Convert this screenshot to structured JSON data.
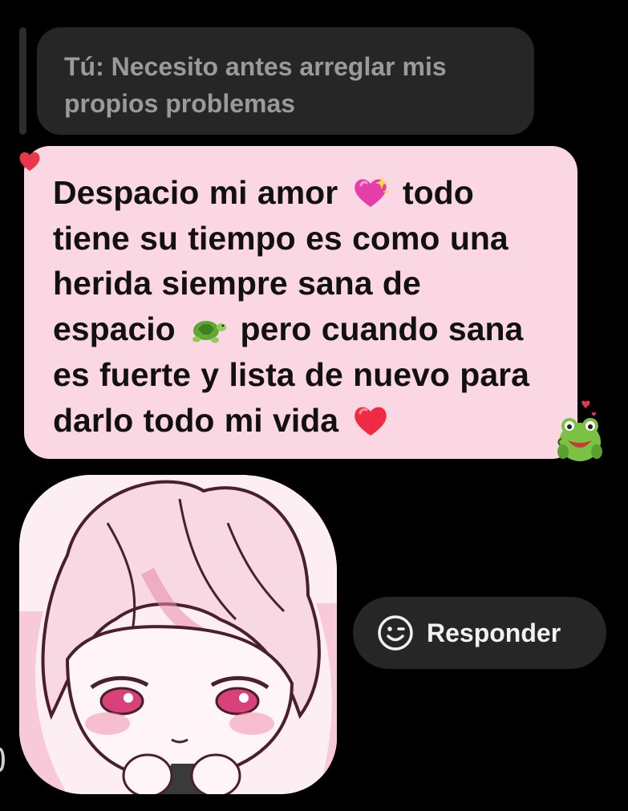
{
  "quoted_message": {
    "text": "Tú: Necesito antes arreglar mis propios problemas"
  },
  "message": {
    "segments": [
      {
        "type": "text",
        "value": "Despacio mi amor "
      },
      {
        "type": "emoji",
        "name": "sparkling-heart-icon"
      },
      {
        "type": "text",
        "value": " todo tiene su tiempo es como una herida siempre sana de espacio "
      },
      {
        "type": "emoji",
        "name": "turtle-icon"
      },
      {
        "type": "text",
        "value": " pero cuando sana es fuerte y lista de nuevo para darlo todo mi vida "
      },
      {
        "type": "emoji",
        "name": "red-heart-icon"
      }
    ],
    "bubble_color": "#fbd6e3"
  },
  "reaction": {
    "icon": "frog-love-sticker-icon"
  },
  "sticker": {
    "icon": "anime-pink-hair-girl-sticker"
  },
  "actions": {
    "reply_label": "Responder",
    "reply_icon": "wink-face-icon"
  },
  "colors": {
    "background": "#000000",
    "quoted_bubble": "#262626",
    "quoted_text": "#9a9a9a",
    "reply_button": "#262626"
  }
}
